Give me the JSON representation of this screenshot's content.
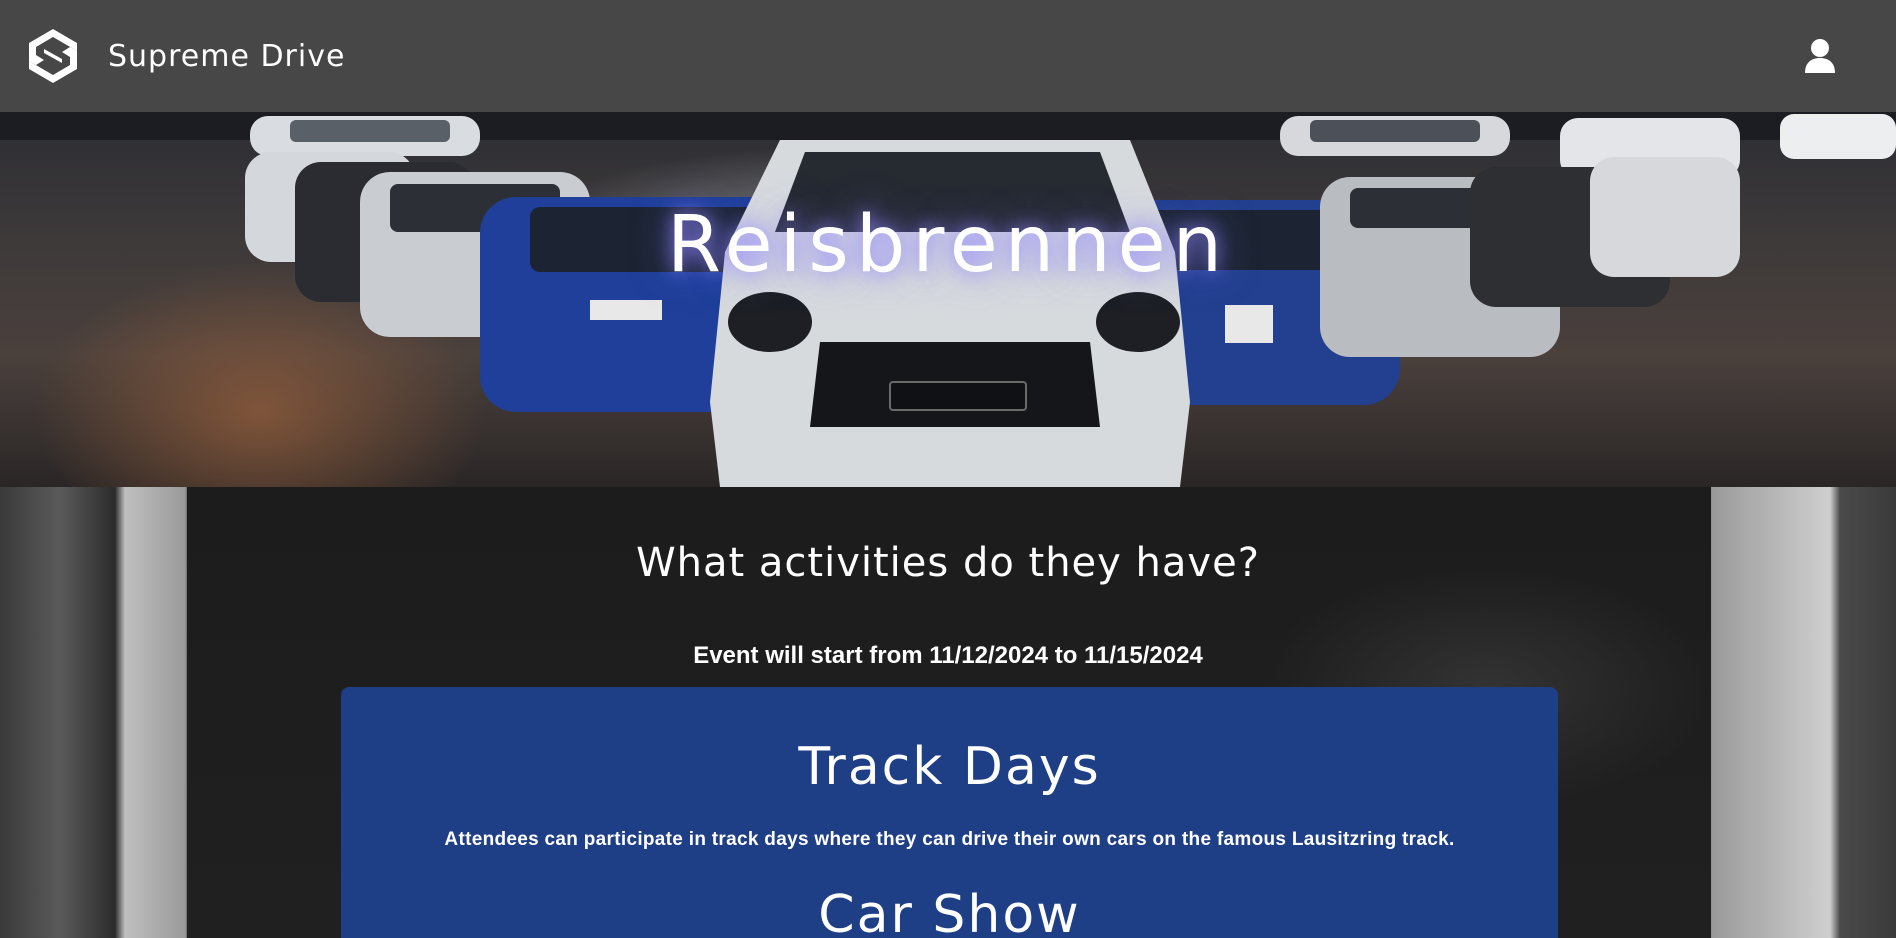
{
  "header": {
    "brand_name": "Supreme Drive",
    "logo_icon": "supreme-drive-logo-icon",
    "user_icon": "user-icon"
  },
  "hero": {
    "title": "Reisbrennen"
  },
  "activities": {
    "heading": "What activities do they have?",
    "dates": "Event will start from 11/12/2024 to 11/15/2024",
    "items": [
      {
        "title": "Track Days",
        "description": "Attendees can participate in track days where they can drive their own cars on the famous Lausitzring track."
      },
      {
        "title": "Car Show",
        "description": ""
      }
    ]
  },
  "colors": {
    "header_bg": "#474747",
    "card_bg": "#1e3e85",
    "text": "#ffffff"
  }
}
